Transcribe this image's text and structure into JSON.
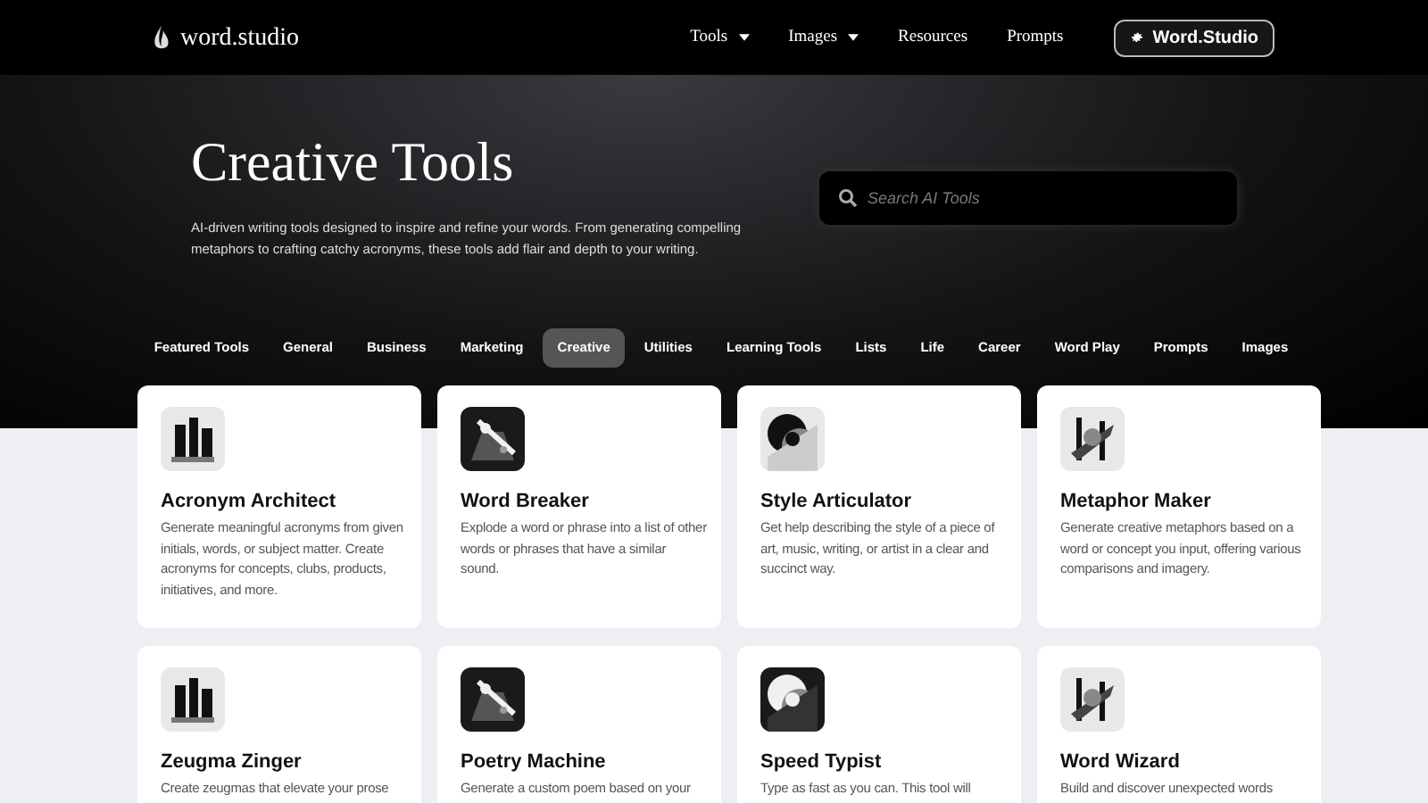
{
  "header": {
    "logo": "word.studio",
    "nav": [
      {
        "label": "Tools",
        "dropdown": true
      },
      {
        "label": "Images",
        "dropdown": true
      },
      {
        "label": "Resources",
        "dropdown": false
      },
      {
        "label": "Prompts",
        "dropdown": false
      }
    ],
    "account_button": "Word.Studio"
  },
  "hero": {
    "title": "Creative Tools",
    "description": "AI-driven writing tools designed to inspire and refine your words. From generating compelling metaphors to crafting catchy acronyms, these tools add flair and depth to your writing.",
    "search": {
      "placeholder": "Search AI Tools"
    }
  },
  "tabs": [
    {
      "label": "Featured Tools",
      "selected": false
    },
    {
      "label": "General",
      "selected": false
    },
    {
      "label": "Business",
      "selected": false
    },
    {
      "label": "Marketing",
      "selected": false
    },
    {
      "label": "Creative",
      "selected": true
    },
    {
      "label": "Utilities",
      "selected": false
    },
    {
      "label": "Learning Tools",
      "selected": false
    },
    {
      "label": "Lists",
      "selected": false
    },
    {
      "label": "Life",
      "selected": false
    },
    {
      "label": "Career",
      "selected": false
    },
    {
      "label": "Word Play",
      "selected": false
    },
    {
      "label": "Prompts",
      "selected": false
    },
    {
      "label": "Images",
      "selected": false
    }
  ],
  "tools": [
    {
      "title": "Acronym Architect",
      "description": "Generate meaningful acronyms from given initials, words, or subject matter. Create acronyms for concepts, clubs, products, initiatives, and more."
    },
    {
      "title": "Word Breaker",
      "description": "Explode a word or phrase into a list of other words or phrases that have a similar sound."
    },
    {
      "title": "Style Articulator",
      "description": "Get help describing the style of a piece of art, music, writing, or artist in a clear and succinct way."
    },
    {
      "title": "Metaphor Maker",
      "description": "Generate creative metaphors based on a word or concept you input, offering various comparisons and imagery."
    },
    {
      "title": "Zeugma Zinger",
      "description": "Create zeugmas that elevate your prose"
    },
    {
      "title": "Poetry Machine",
      "description": "Generate a custom poem based on your"
    },
    {
      "title": "Speed Typist",
      "description": "Type as fast as you can. This tool will"
    },
    {
      "title": "Word Wizard",
      "description": "Build and discover unexpected words"
    }
  ]
}
